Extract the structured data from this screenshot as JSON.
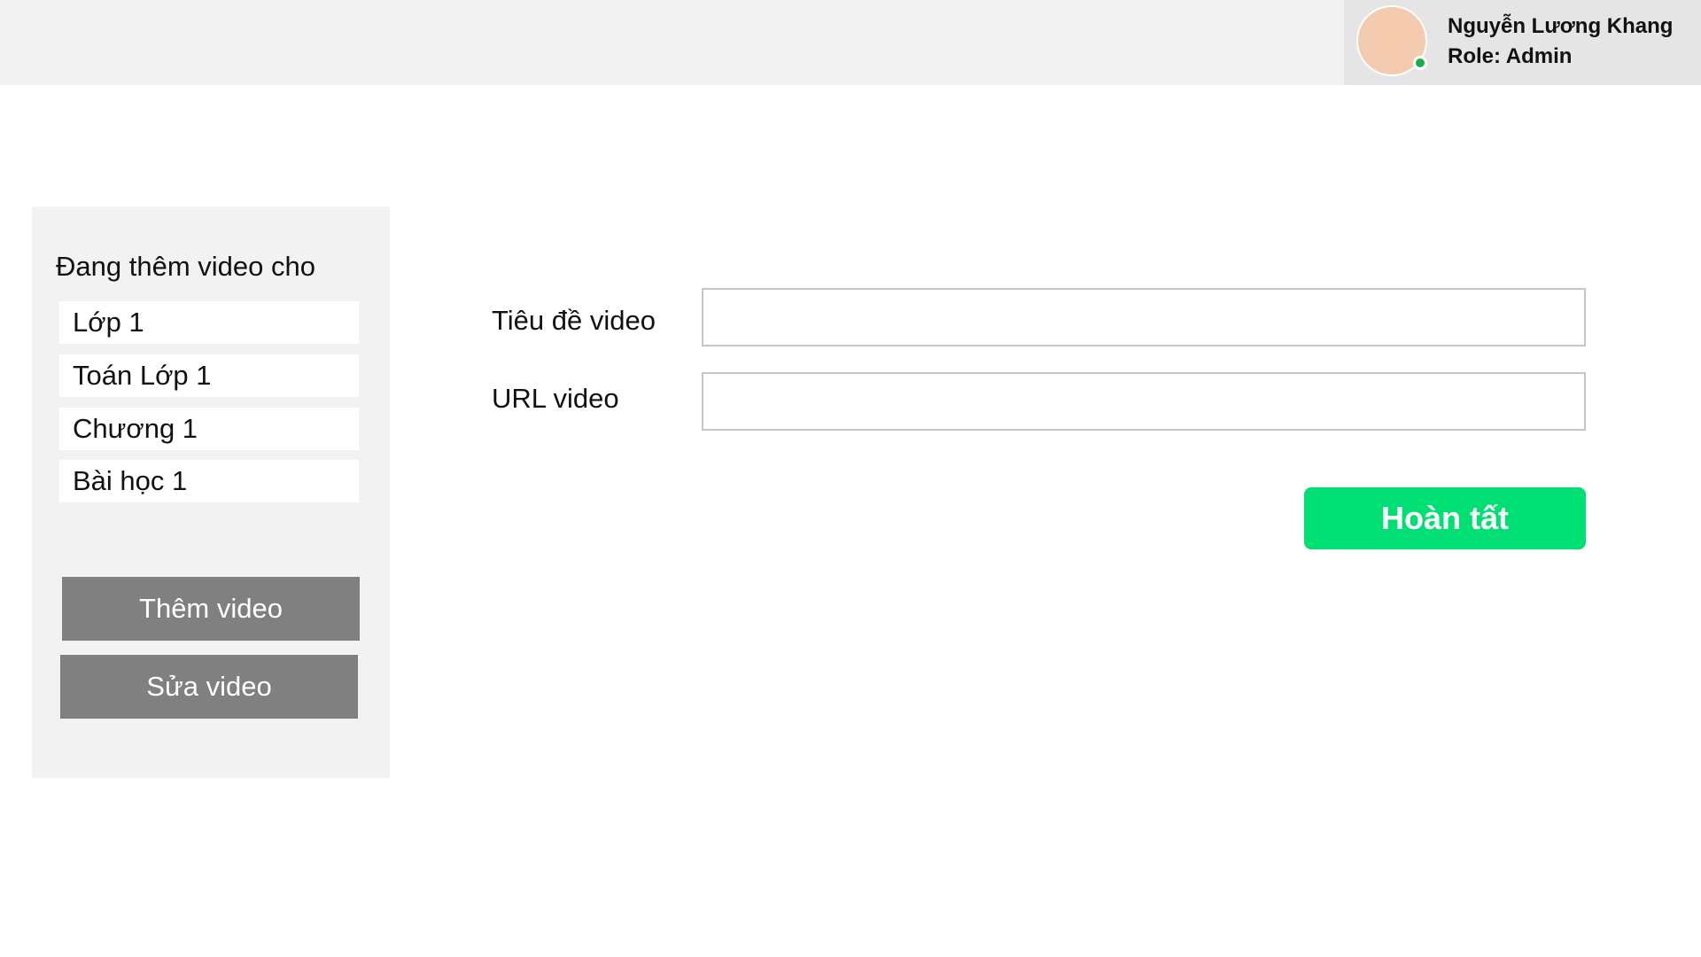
{
  "user": {
    "name": "Nguyễn Lương Khang",
    "role": "Role: Admin"
  },
  "panel": {
    "title": "Đang thêm video cho",
    "path": [
      "Lớp 1",
      "Toán Lớp 1",
      "Chương 1",
      "Bài học 1"
    ],
    "add_video": "Thêm video",
    "edit_video": "Sửa video"
  },
  "form": {
    "title_label": "Tiêu đề video",
    "title_value": "",
    "url_label": "URL video",
    "url_value": "",
    "submit": "Hoàn tất"
  }
}
